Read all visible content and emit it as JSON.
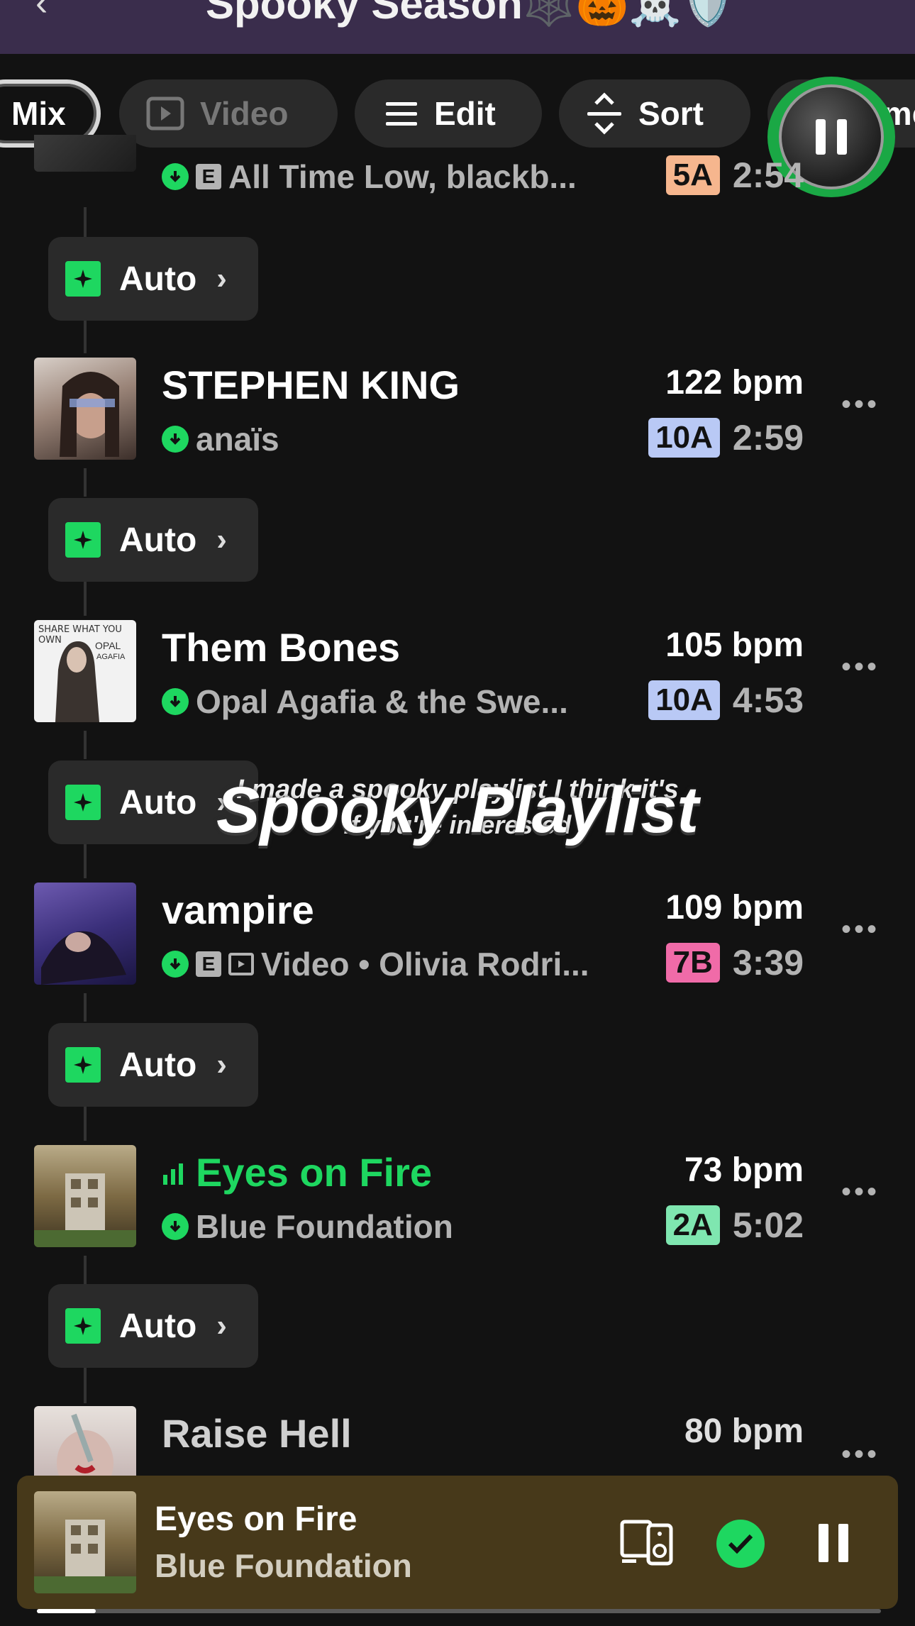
{
  "header": {
    "back_icon": "back-arrow-icon",
    "title": "Spooky Season🕸️🎃☠️🛡️"
  },
  "chips": {
    "mix": "Mix",
    "video": "Video",
    "edit": "Edit",
    "sort": "Sort",
    "name": "Name"
  },
  "tracks": [
    {
      "title": "",
      "subtitle": "All Time Low, blackb...",
      "explicit": "E",
      "key": "5A",
      "key_color": "#f6b68e",
      "duration": "2:54",
      "bpm": ""
    },
    {
      "title": "STEPHEN KING",
      "subtitle": "anaïs",
      "bpm": "122 bpm",
      "key": "10A",
      "key_color": "#b9c9f5",
      "duration": "2:59"
    },
    {
      "title": "Them Bones",
      "subtitle": "Opal Agafia & the Swe...",
      "bpm": "105 bpm",
      "key": "10A",
      "key_color": "#b9c9f5",
      "duration": "4:53",
      "art_text": [
        "SHARE WHAT YOU OWN",
        "OPAL",
        "AGAFIA"
      ]
    },
    {
      "title": "vampire",
      "subtitle": "Video • Olivia Rodri...",
      "explicit": "E",
      "bpm": "109 bpm",
      "key": "7B",
      "key_color": "#f06ba8",
      "duration": "3:39"
    },
    {
      "title": "Eyes on Fire",
      "subtitle": "Blue Foundation",
      "bpm": "73 bpm",
      "key": "2A",
      "key_color": "#7fe6b0",
      "duration": "5:02"
    },
    {
      "title": "Raise Hell",
      "subtitle": "",
      "bpm": "80 bpm",
      "key": "",
      "duration": ""
    }
  ],
  "auto_label": "Auto",
  "overlay": {
    "line1": "I made a spooky playlist I think it's",
    "line2": "if you're interested",
    "big": "Spooky Playlist"
  },
  "now_playing": {
    "title": "Eyes on Fire",
    "artist": "Blue Foundation",
    "progress": 0.07
  },
  "colors": {
    "accent": "#1ed760",
    "header_bg": "#3a2d4c",
    "now_playing_bg": "#47391a"
  }
}
